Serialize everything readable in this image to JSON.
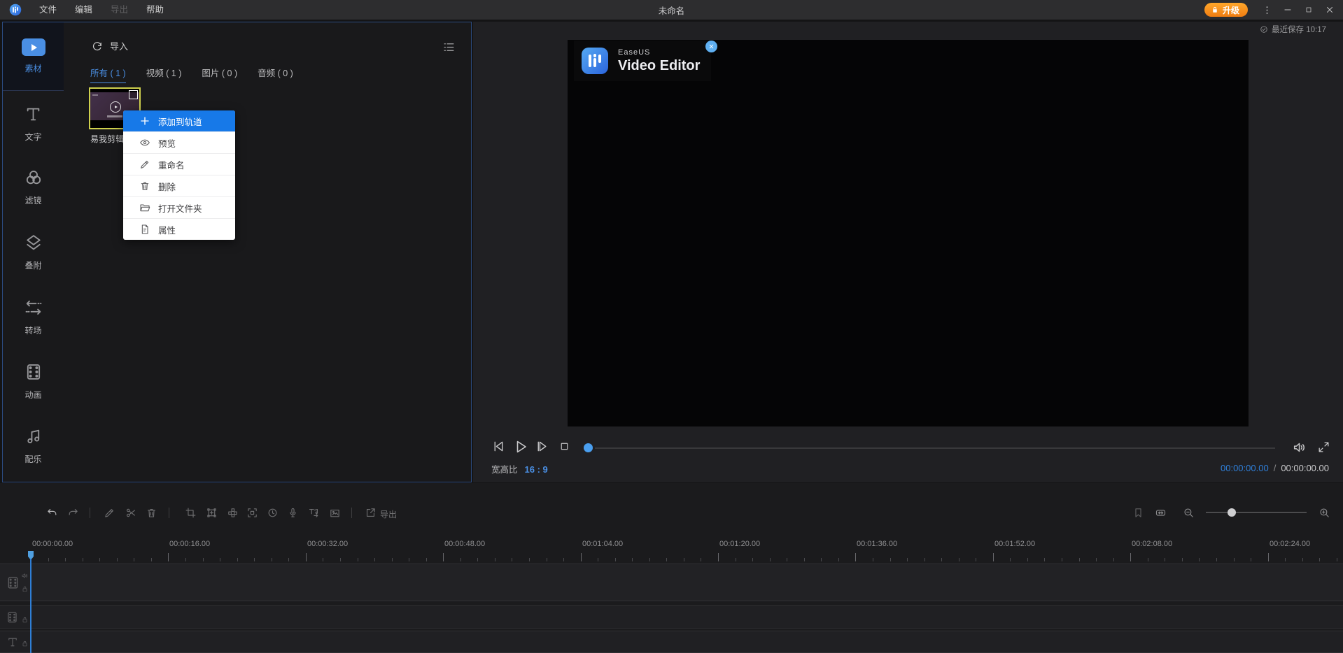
{
  "titlebar": {
    "menus": [
      "文件",
      "编辑",
      "导出",
      "帮助"
    ],
    "title": "未命名",
    "upgrade_label": "升级",
    "saved_status": "最近保存 10:17"
  },
  "sidebar": {
    "items": [
      {
        "label": "素材",
        "active": true
      },
      {
        "label": "文字"
      },
      {
        "label": "滤镜"
      },
      {
        "label": "叠附"
      },
      {
        "label": "转场"
      },
      {
        "label": "动画"
      },
      {
        "label": "配乐"
      }
    ]
  },
  "media_panel": {
    "import_label": "导入",
    "tabs": [
      {
        "label": "所有 ( 1 )",
        "active": true
      },
      {
        "label": "视频 ( 1 )"
      },
      {
        "label": "图片 ( 0 )"
      },
      {
        "label": "音频 ( 0 )"
      }
    ],
    "clip_name": "易我剪辑"
  },
  "context_menu": {
    "items": [
      {
        "label": "添加到轨道",
        "icon": "plus-icon",
        "highlighted": true
      },
      {
        "label": "预览",
        "icon": "eye-icon"
      },
      {
        "label": "重命名",
        "icon": "pencil-icon"
      },
      {
        "label": "删除",
        "icon": "trash-icon"
      },
      {
        "label": "打开文件夹",
        "icon": "folder-icon"
      },
      {
        "label": "属性",
        "icon": "document-icon"
      }
    ]
  },
  "preview": {
    "watermark_line1": "EaseUS",
    "watermark_line2": "Video Editor",
    "aspect_ratio_label": "宽高比",
    "aspect_ratio_value": "16 : 9",
    "time_current": "00:00:00.00",
    "time_separator": "/",
    "time_total": "00:00:00.00"
  },
  "toolbar": {
    "export_label": "导出"
  },
  "timeline": {
    "ruler_labels": [
      "00:00:00.00",
      "00:00:16.00",
      "00:00:32.00",
      "00:00:48.00",
      "00:01:04.00",
      "00:01:20.00",
      "00:01:36.00",
      "00:01:52.00",
      "00:02:08.00",
      "00:02:24.00"
    ]
  },
  "colors": {
    "accent_blue": "#4a8fe4",
    "menu_highlight_blue": "#1779e8",
    "upgrade_orange": "#f5861f",
    "selection_yellow": "#cfd14d",
    "playhead_blue": "#2f7fd6"
  }
}
